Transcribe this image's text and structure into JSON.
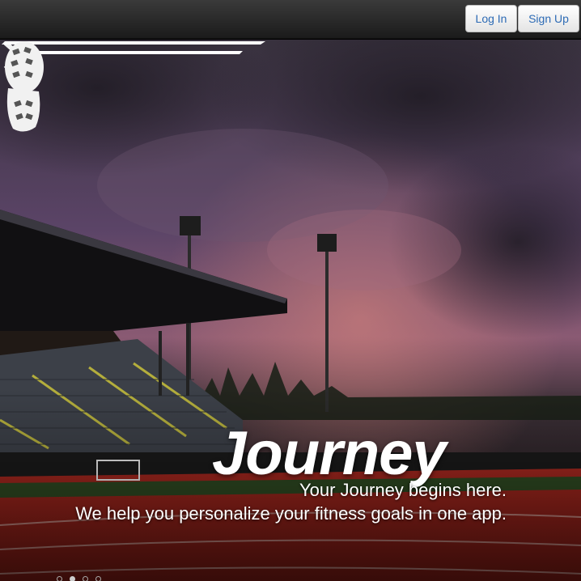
{
  "header": {
    "login_label": "Log In",
    "signup_label": "Sign Up"
  },
  "hero": {
    "logo_text": "Journey",
    "tagline_line1": "Your Journey begins here.",
    "tagline_line2": "We help you personalize your fitness goals in one app.",
    "next_icon": "chevron-right-icon",
    "slide_count": 4,
    "active_slide": 2
  },
  "colors": {
    "link_blue": "#2d6bb5",
    "track_red": "#b3271f",
    "sky_purple": "#5b4467"
  }
}
